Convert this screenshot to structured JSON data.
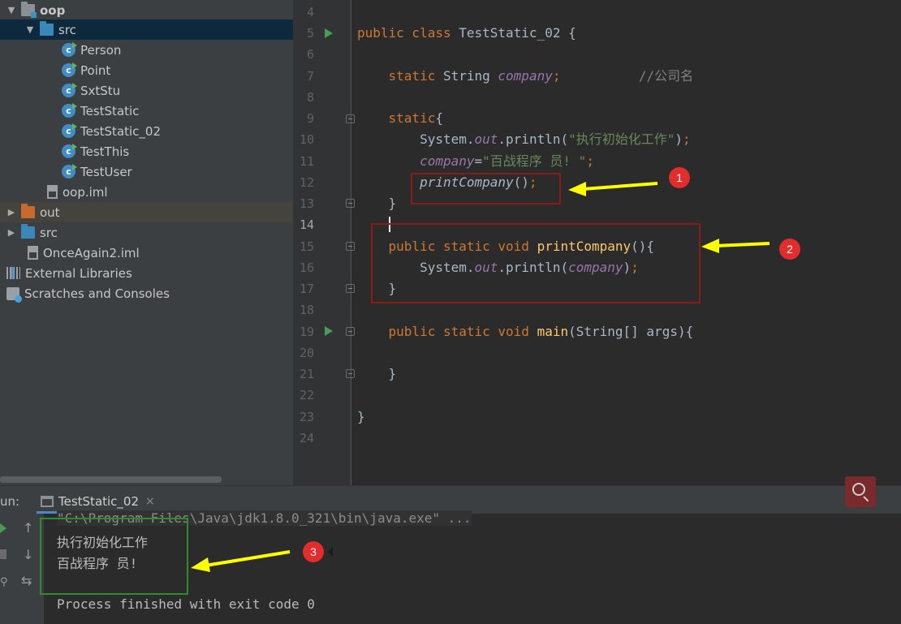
{
  "tree": {
    "items": [
      {
        "label": "oop",
        "arrow": "▼",
        "icon": "folder-gray",
        "bold": true
      },
      {
        "label": "src",
        "arrow": "▼",
        "icon": "folder-blue"
      },
      {
        "label": "Person",
        "icon": "class"
      },
      {
        "label": "Point",
        "icon": "class"
      },
      {
        "label": "SxtStu",
        "icon": "class"
      },
      {
        "label": "TestStatic",
        "icon": "class"
      },
      {
        "label": "TestStatic_02",
        "icon": "class"
      },
      {
        "label": "TestThis",
        "icon": "class"
      },
      {
        "label": "TestUser",
        "icon": "class"
      },
      {
        "label": "oop.iml",
        "icon": "file"
      },
      {
        "label": "out",
        "arrow": "▶",
        "icon": "folder-orange"
      },
      {
        "label": "src",
        "arrow": "▶",
        "icon": "folder-blue"
      },
      {
        "label": "OnceAgain2.iml",
        "icon": "file"
      },
      {
        "label": "External Libraries",
        "arrow": "▶",
        "icon": "libraries"
      },
      {
        "label": "Scratches and Consoles",
        "icon": "scratch"
      }
    ]
  },
  "editor": {
    "line_numbers": [
      "4",
      "5",
      "6",
      "7",
      "8",
      "9",
      "10",
      "11",
      "12",
      "13",
      "14",
      "15",
      "16",
      "17",
      "18",
      "19",
      "20",
      "21",
      "22",
      "23",
      "24"
    ],
    "current_line": "14",
    "code": {
      "l5": {
        "kw": "public class ",
        "name": "TestStatic_02 {"
      },
      "l7": {
        "kw": "static ",
        "type": "String ",
        "field": "company",
        "semi": ";",
        "comment": "//公司名"
      },
      "l9": {
        "kw": "static",
        "brace": "{"
      },
      "l10": {
        "pre": "System.",
        "field": "out",
        "mid": ".println(",
        "str": "\"执行初始化工作\"",
        "post": ")",
        "semi": ";"
      },
      "l11": {
        "field": "company",
        "eq": "=",
        "str": "\"百战程序 员! \"",
        "semi": ";"
      },
      "l12": {
        "call": "printCompany",
        "post": "()",
        "semi": ";"
      },
      "l13": {
        "brace": "}"
      },
      "l15": {
        "kw": "public static void ",
        "fn": "printCompany",
        "post": "(){"
      },
      "l16": {
        "pre": "System.",
        "field": "out",
        "mid": ".println(",
        "field2": "company",
        "post": ")",
        "semi": ";"
      },
      "l17": {
        "brace": "}"
      },
      "l19": {
        "kw": "public static void ",
        "fn": "main",
        "post": "(String[] args){"
      },
      "l21": {
        "brace": "}"
      },
      "l23": {
        "brace": "}"
      }
    },
    "badges": [
      "1",
      "2"
    ]
  },
  "run": {
    "label": "un:",
    "tab_label": "TestStatic_02",
    "tab_close": "×",
    "console": {
      "command": "\"C:\\Program Files\\Java\\jdk1.8.0_321\\bin\\java.exe\" ...",
      "out1": "执行初始化工作",
      "out2": "百战程序 员!",
      "finished": "Process finished with exit code 0"
    },
    "badge": "3",
    "tools": {
      "up": "↑",
      "down": "↓",
      "wrap": "⇆"
    }
  },
  "colors": {
    "annotation_red": "#8b1a1a",
    "annotation_green": "#2e8b2e",
    "arrow_yellow": "#ffff00",
    "badge_red": "#e22d2d"
  }
}
